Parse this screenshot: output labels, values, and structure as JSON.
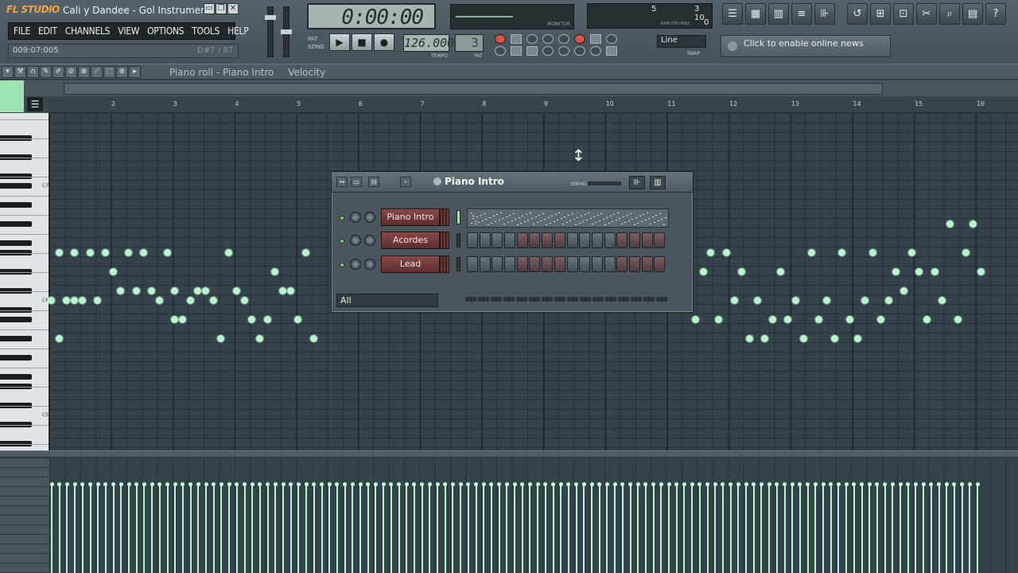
{
  "window": {
    "app_logo": "FL STUDIO",
    "title": "Cali y Dandee - Gol Instrumen...",
    "buttons": [
      "▭",
      "❐",
      "✕"
    ]
  },
  "menu": {
    "items": [
      "FILE",
      "EDIT",
      "CHANNELS",
      "VIEW",
      "OPTIONS",
      "TOOLS",
      "HELP"
    ]
  },
  "hint": {
    "position": "009:07:005",
    "note": "D#7 / 87"
  },
  "transport": {
    "time": "0:00:00",
    "pat_label": "PAT",
    "song_label": "SONG",
    "tempo": "126.000",
    "tempo_label": "TEMPO",
    "pattern": "3",
    "pattern_label": "PAT",
    "monitor_label": "MONITOR",
    "snap": "Line",
    "snap_label": "SNAP"
  },
  "cpu": {
    "cpu_val": "5",
    "poly_val": "3 10",
    "extra": "0",
    "labels": "RAM  CPU  POLY"
  },
  "news": {
    "text": "Click to enable online news"
  },
  "piano_roll": {
    "title": "Piano roll - Piano Intro",
    "velocity_label": "Velocity",
    "ruler_ticks": [
      "2",
      "3",
      "4",
      "5",
      "6",
      "7",
      "8",
      "9",
      "10",
      "11",
      "12",
      "13",
      "14",
      "15",
      "16"
    ],
    "key_labels": [
      "C7",
      "C6",
      "C5"
    ]
  },
  "step_sequencer": {
    "title": "Piano Intro",
    "swing_label": "SWING",
    "filter": "All",
    "channels": [
      {
        "name": "Piano Intro",
        "mode": "piano-roll",
        "selected": true
      },
      {
        "name": "Acordes",
        "mode": "steps",
        "selected": false
      },
      {
        "name": "Lead",
        "mode": "steps",
        "selected": false
      }
    ]
  },
  "colors": {
    "note": "#b8f5cc",
    "grid_bg": "#34434a",
    "channel_button": "#7a4240",
    "accent": "#f0a640"
  },
  "icons": [
    "play-icon",
    "stop-icon",
    "record-icon",
    "playlist-icon",
    "step-sequencer-icon",
    "piano-roll-icon",
    "browser-icon",
    "mixer-icon",
    "undo-icon",
    "save-icon",
    "export-icon",
    "cut-icon",
    "search-icon",
    "project-info-icon",
    "help-icon",
    "globe-icon"
  ]
}
